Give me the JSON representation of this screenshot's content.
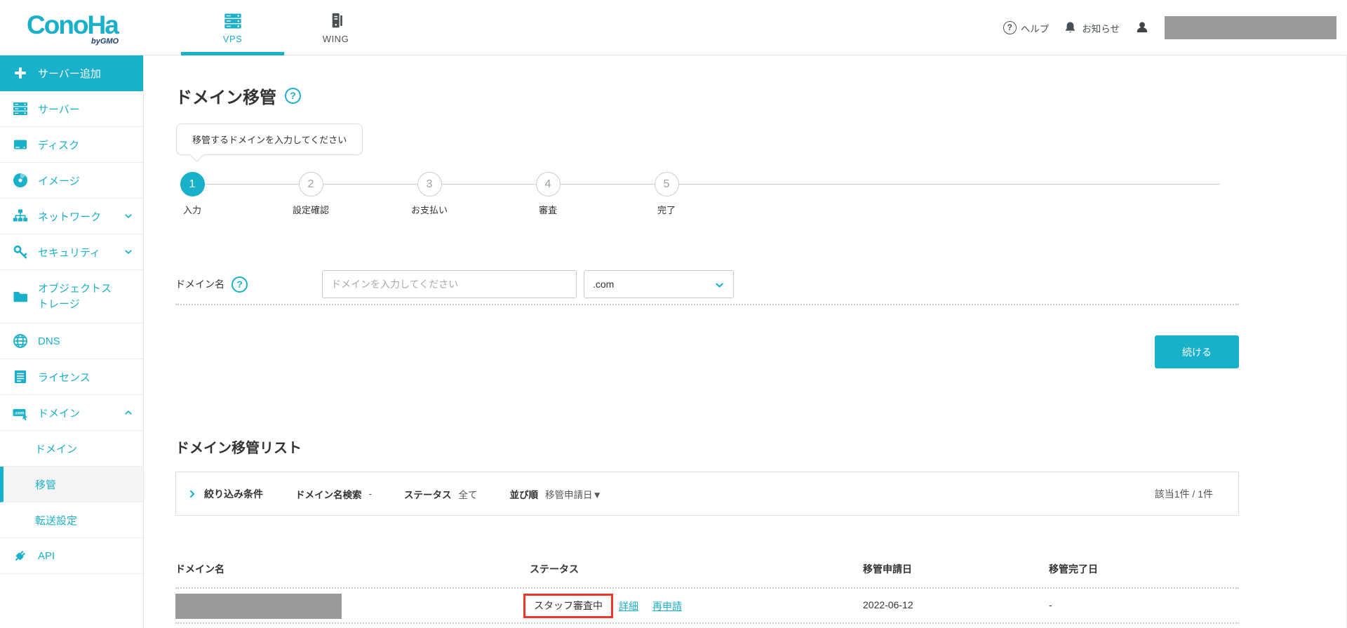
{
  "colors": {
    "accent": "#19b0c9",
    "red": "#e8392a",
    "redact": "#9a9a9a",
    "navy": "#1c3d6e"
  },
  "header": {
    "logo_text": "ConoHa",
    "logo_sub": "byGMO",
    "tabs": [
      {
        "label": "VPS",
        "icon": "server-icon",
        "active": true
      },
      {
        "label": "WING",
        "icon": "tower-icon",
        "active": false
      }
    ],
    "help": "ヘルプ",
    "notice": "お知らせ"
  },
  "sidebar": {
    "items": [
      {
        "label": "サーバー追加",
        "icon": "plus-icon",
        "active": true
      },
      {
        "label": "サーバー",
        "icon": "server-icon"
      },
      {
        "label": "ディスク",
        "icon": "disk-icon"
      },
      {
        "label": "イメージ",
        "icon": "disc-icon"
      },
      {
        "label": "ネットワーク",
        "icon": "network-icon",
        "chevron": "down"
      },
      {
        "label": "セキュリティ",
        "icon": "key-icon",
        "chevron": "down"
      },
      {
        "label": "オブジェクトストレージ",
        "icon": "folder-icon"
      },
      {
        "label": "DNS",
        "icon": "globe-icon"
      },
      {
        "label": "ライセンス",
        "icon": "document-icon"
      },
      {
        "label": "ドメイン",
        "icon": "dotcom-icon",
        "chevron": "up",
        "expanded": true
      },
      {
        "label": "ドメイン",
        "sub": true
      },
      {
        "label": "移管",
        "sub": true,
        "active": true
      },
      {
        "label": "転送設定",
        "sub": true
      },
      {
        "label": "API",
        "icon": "plug-icon"
      }
    ]
  },
  "page": {
    "title": "ドメイン移管",
    "tooltip": "移管するドメインを入力してください",
    "steps": [
      {
        "num": "1",
        "label": "入力",
        "active": true
      },
      {
        "num": "2",
        "label": "設定確認",
        "active": false
      },
      {
        "num": "3",
        "label": "お支払い",
        "active": false
      },
      {
        "num": "4",
        "label": "審査",
        "active": false
      },
      {
        "num": "5",
        "label": "完了",
        "active": false
      }
    ],
    "form": {
      "label": "ドメイン名",
      "placeholder": "ドメインを入力してください",
      "tld": ".com",
      "continue_label": "続ける"
    }
  },
  "list": {
    "title": "ドメイン移管リスト",
    "filter": {
      "toggle": "絞り込み条件",
      "search_label": "ドメイン名検索",
      "search_value": "-",
      "status_label": "ステータス",
      "status_value": "全て",
      "sort_label": "並び順",
      "sort_value": "移管申請日▼",
      "count": "該当1件 / 1件"
    },
    "table": {
      "headers": [
        "ドメイン名",
        "ステータス",
        "移管申請日",
        "移管完了日"
      ],
      "row": {
        "status": "スタッフ審査中",
        "detail_link": "詳細",
        "reapply_link": "再申請",
        "apply_date": "2022-06-12",
        "complete_date": "-"
      }
    }
  }
}
